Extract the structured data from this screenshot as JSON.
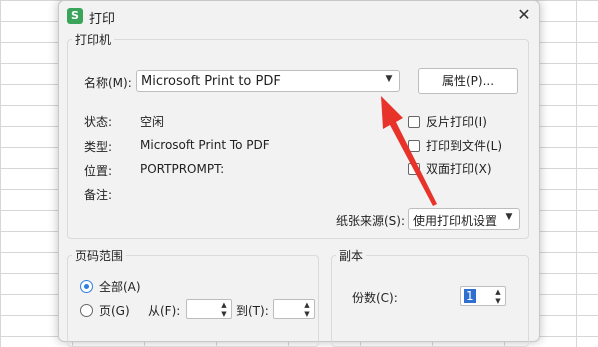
{
  "dialog": {
    "title": "打印",
    "app_icon_letter": "S"
  },
  "printer": {
    "legend": "打印机",
    "name_label": "名称(M):",
    "name_value": "Microsoft Print to PDF",
    "properties_button": "属性(P)...",
    "status_label": "状态:",
    "status_value": "空闲",
    "type_label": "类型:",
    "type_value": "Microsoft Print To PDF",
    "location_label": "位置:",
    "location_value": "PORTPROMPT:",
    "comment_label": "备注:",
    "options": [
      {
        "label": "反片打印(I)",
        "checked": false
      },
      {
        "label": "打印到文件(L)",
        "checked": false
      },
      {
        "label": "双面打印(X)",
        "checked": false
      }
    ],
    "paper_source_label": "纸张来源(S):",
    "paper_source_value": "使用打印机设置"
  },
  "page_range": {
    "legend": "页码范围",
    "all_label": "全部(A)",
    "pages_label": "页(G)",
    "from_label": "从(F):",
    "to_label": "到(T):"
  },
  "copies": {
    "legend": "副本",
    "count_label": "份数(C):",
    "count_value": "1"
  },
  "colors": {
    "accent": "#2f7de1",
    "annotation": "#e8332b"
  }
}
